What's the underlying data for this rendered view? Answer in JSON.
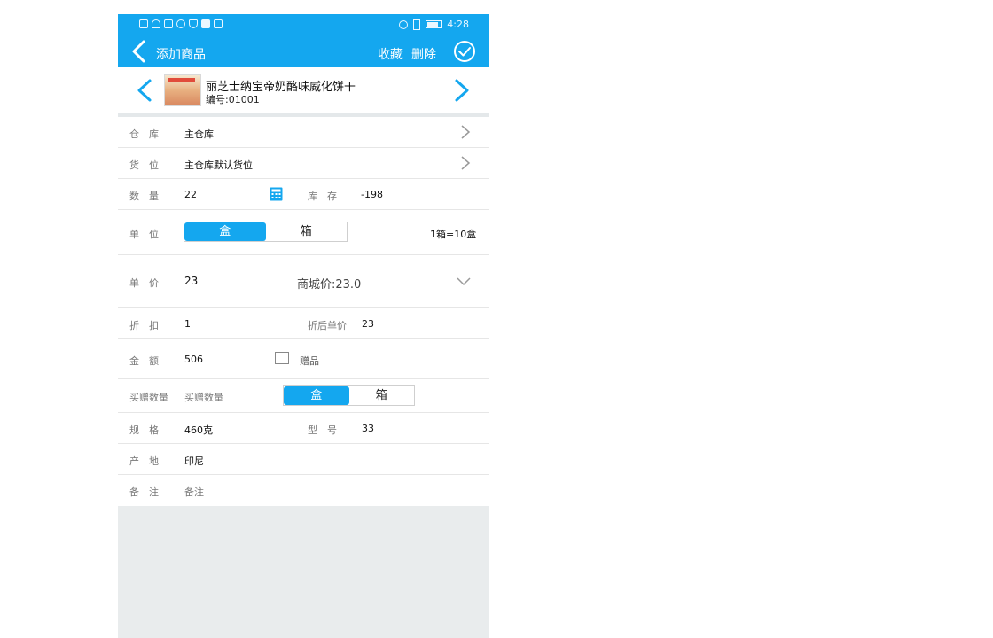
{
  "status": {
    "time": "4:28"
  },
  "appbar": {
    "title": "添加商品",
    "favorite": "收藏",
    "delete": "删除"
  },
  "product": {
    "name": "丽芝士纳宝帝奶酪味威化饼干",
    "code": "编号:01001"
  },
  "form": {
    "warehouse": {
      "label": "仓　库",
      "value": "主仓库"
    },
    "location": {
      "label": "货　位",
      "value": "主仓库默认货位"
    },
    "quantity": {
      "label": "数　量",
      "value": "22",
      "stock_label": "库　存",
      "stock_value": "-198"
    },
    "unit": {
      "label": "单　位",
      "options": [
        "盒",
        "箱"
      ],
      "selected": "盒",
      "conversion": "1箱=10盒"
    },
    "price": {
      "label": "单　价",
      "value": "23",
      "mall_price": "商城价:23.0"
    },
    "discount": {
      "label": "折　扣",
      "value": "1",
      "after_label": "折后单价",
      "after_value": "23"
    },
    "amount": {
      "label": "金　额",
      "value": "506",
      "gift_label": "赠品"
    },
    "buy_gift": {
      "label": "买赠数量",
      "placeholder": "买赠数量",
      "options": [
        "盒",
        "箱"
      ],
      "selected": "盒"
    },
    "spec": {
      "label": "规　格",
      "value": "460克",
      "model_label": "型　号",
      "model_value": "33"
    },
    "origin": {
      "label": "产　地",
      "value": "印尼"
    },
    "remark": {
      "label": "备　注",
      "placeholder": "备注"
    }
  },
  "colors": {
    "accent": "#14a7ef",
    "background": "#e9eced"
  }
}
